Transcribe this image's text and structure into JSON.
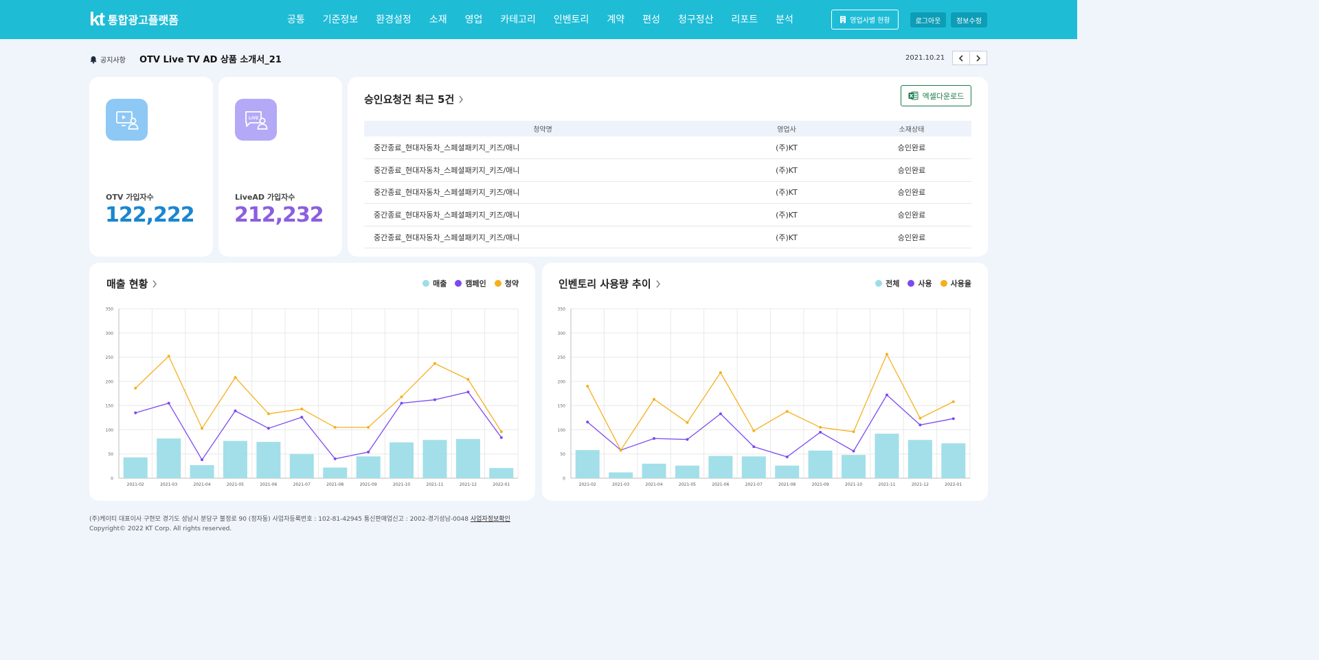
{
  "header": {
    "logo": "kt",
    "brand": "통합광고플랫폼",
    "nav": [
      "공통",
      "기준정보",
      "환경설정",
      "소재",
      "영업",
      "카테고리",
      "인벤토리",
      "계약",
      "편성",
      "청구정산",
      "리포트",
      "분석"
    ],
    "branch_button": "영업사별 현황",
    "logout": "로그아웃",
    "edit_info": "정보수정"
  },
  "notice": {
    "label": "공지사항",
    "title": "OTV Live TV AD 상품 소개서_21",
    "date": "2021.10.21"
  },
  "stats": [
    {
      "label": "OTV 가입자수",
      "value": "122,222",
      "color": "#1a86d0",
      "icon_bg": "#8ec8f5",
      "icon": "tv-user-icon"
    },
    {
      "label": "LiveAD 가입자수",
      "value": "212,232",
      "color": "#8c5fde",
      "icon_bg": "#b4a9f6",
      "icon": "live-user-icon"
    }
  ],
  "approvals": {
    "title": "승인요청건 최근 5건",
    "excel_button": "엑셀다운로드",
    "columns": [
      "청약명",
      "영업사",
      "소재상태"
    ],
    "rows": [
      [
        "중간종료_현대자동차_스페셜패키지_키즈/애니",
        "(주)KT",
        "승인완료"
      ],
      [
        "중간종료_현대자동차_스페셜패키지_키즈/애니",
        "(주)KT",
        "승인완료"
      ],
      [
        "중간종료_현대자동차_스페셜패키지_키즈/애니",
        "(주)KT",
        "승인완료"
      ],
      [
        "중간종료_현대자동차_스페셜패키지_키즈/애니",
        "(주)KT",
        "승인완료"
      ],
      [
        "중간종료_현대자동차_스페셜패키지_키즈/애니",
        "(주)KT",
        "승인완료"
      ]
    ]
  },
  "colors": {
    "bar": "#9ddde8",
    "line_purple": "#7b49f0",
    "line_orange": "#f5b01d"
  },
  "chart_data": [
    {
      "type": "bar",
      "title": "매출 현황",
      "categories": [
        "2021-02",
        "2021-03",
        "2021-04",
        "2021-05",
        "2021-06",
        "2021-07",
        "2021-08",
        "2021-09",
        "2021-10",
        "2021-11",
        "2021-12",
        "2022-01"
      ],
      "ylim": [
        0,
        350
      ],
      "yticks": [
        0,
        50,
        100,
        150,
        200,
        250,
        300,
        350
      ],
      "grid": true,
      "legend_position": "top-right",
      "series": [
        {
          "name": "매출",
          "type": "bar",
          "values": [
            43,
            82,
            27,
            77,
            75,
            50,
            22,
            45,
            74,
            79,
            81,
            21
          ]
        },
        {
          "name": "캠페인",
          "type": "line",
          "values": [
            135,
            155,
            38,
            139,
            103,
            126,
            40,
            54,
            155,
            162,
            178,
            84
          ]
        },
        {
          "name": "청약",
          "type": "line",
          "values": [
            186,
            252,
            103,
            208,
            133,
            143,
            105,
            105,
            168,
            237,
            204,
            96
          ]
        }
      ]
    },
    {
      "type": "bar",
      "title": "인벤토리 사용량 추이",
      "categories": [
        "2021-02",
        "2021-03",
        "2021-04",
        "2021-05",
        "2021-06",
        "2021-07",
        "2021-08",
        "2021-09",
        "2021-10",
        "2021-11",
        "2021-12",
        "2022-01"
      ],
      "ylim": [
        0,
        350
      ],
      "yticks": [
        0,
        50,
        100,
        150,
        200,
        250,
        300,
        350
      ],
      "grid": true,
      "legend_position": "top-right",
      "series": [
        {
          "name": "전체",
          "type": "bar",
          "values": [
            58,
            12,
            30,
            26,
            46,
            45,
            26,
            57,
            48,
            92,
            79,
            72
          ]
        },
        {
          "name": "사용",
          "type": "line",
          "values": [
            116,
            58,
            82,
            80,
            133,
            65,
            44,
            95,
            56,
            172,
            110,
            123
          ]
        },
        {
          "name": "사용율",
          "type": "line",
          "values": [
            190,
            58,
            163,
            115,
            218,
            98,
            138,
            105,
            96,
            256,
            124,
            158
          ]
        }
      ]
    }
  ],
  "footer": {
    "line1": "(주)케이티 대표이사 구현모 경기도 성남시 분당구 불정로 90 (정자동) 사업자등록번호 : 102-81-42945 통신판매업신고 : 2002-경기성남-0048",
    "link": "사업자정보확인",
    "line2": "Copyright© 2022 KT Corp. All rights reserved."
  }
}
